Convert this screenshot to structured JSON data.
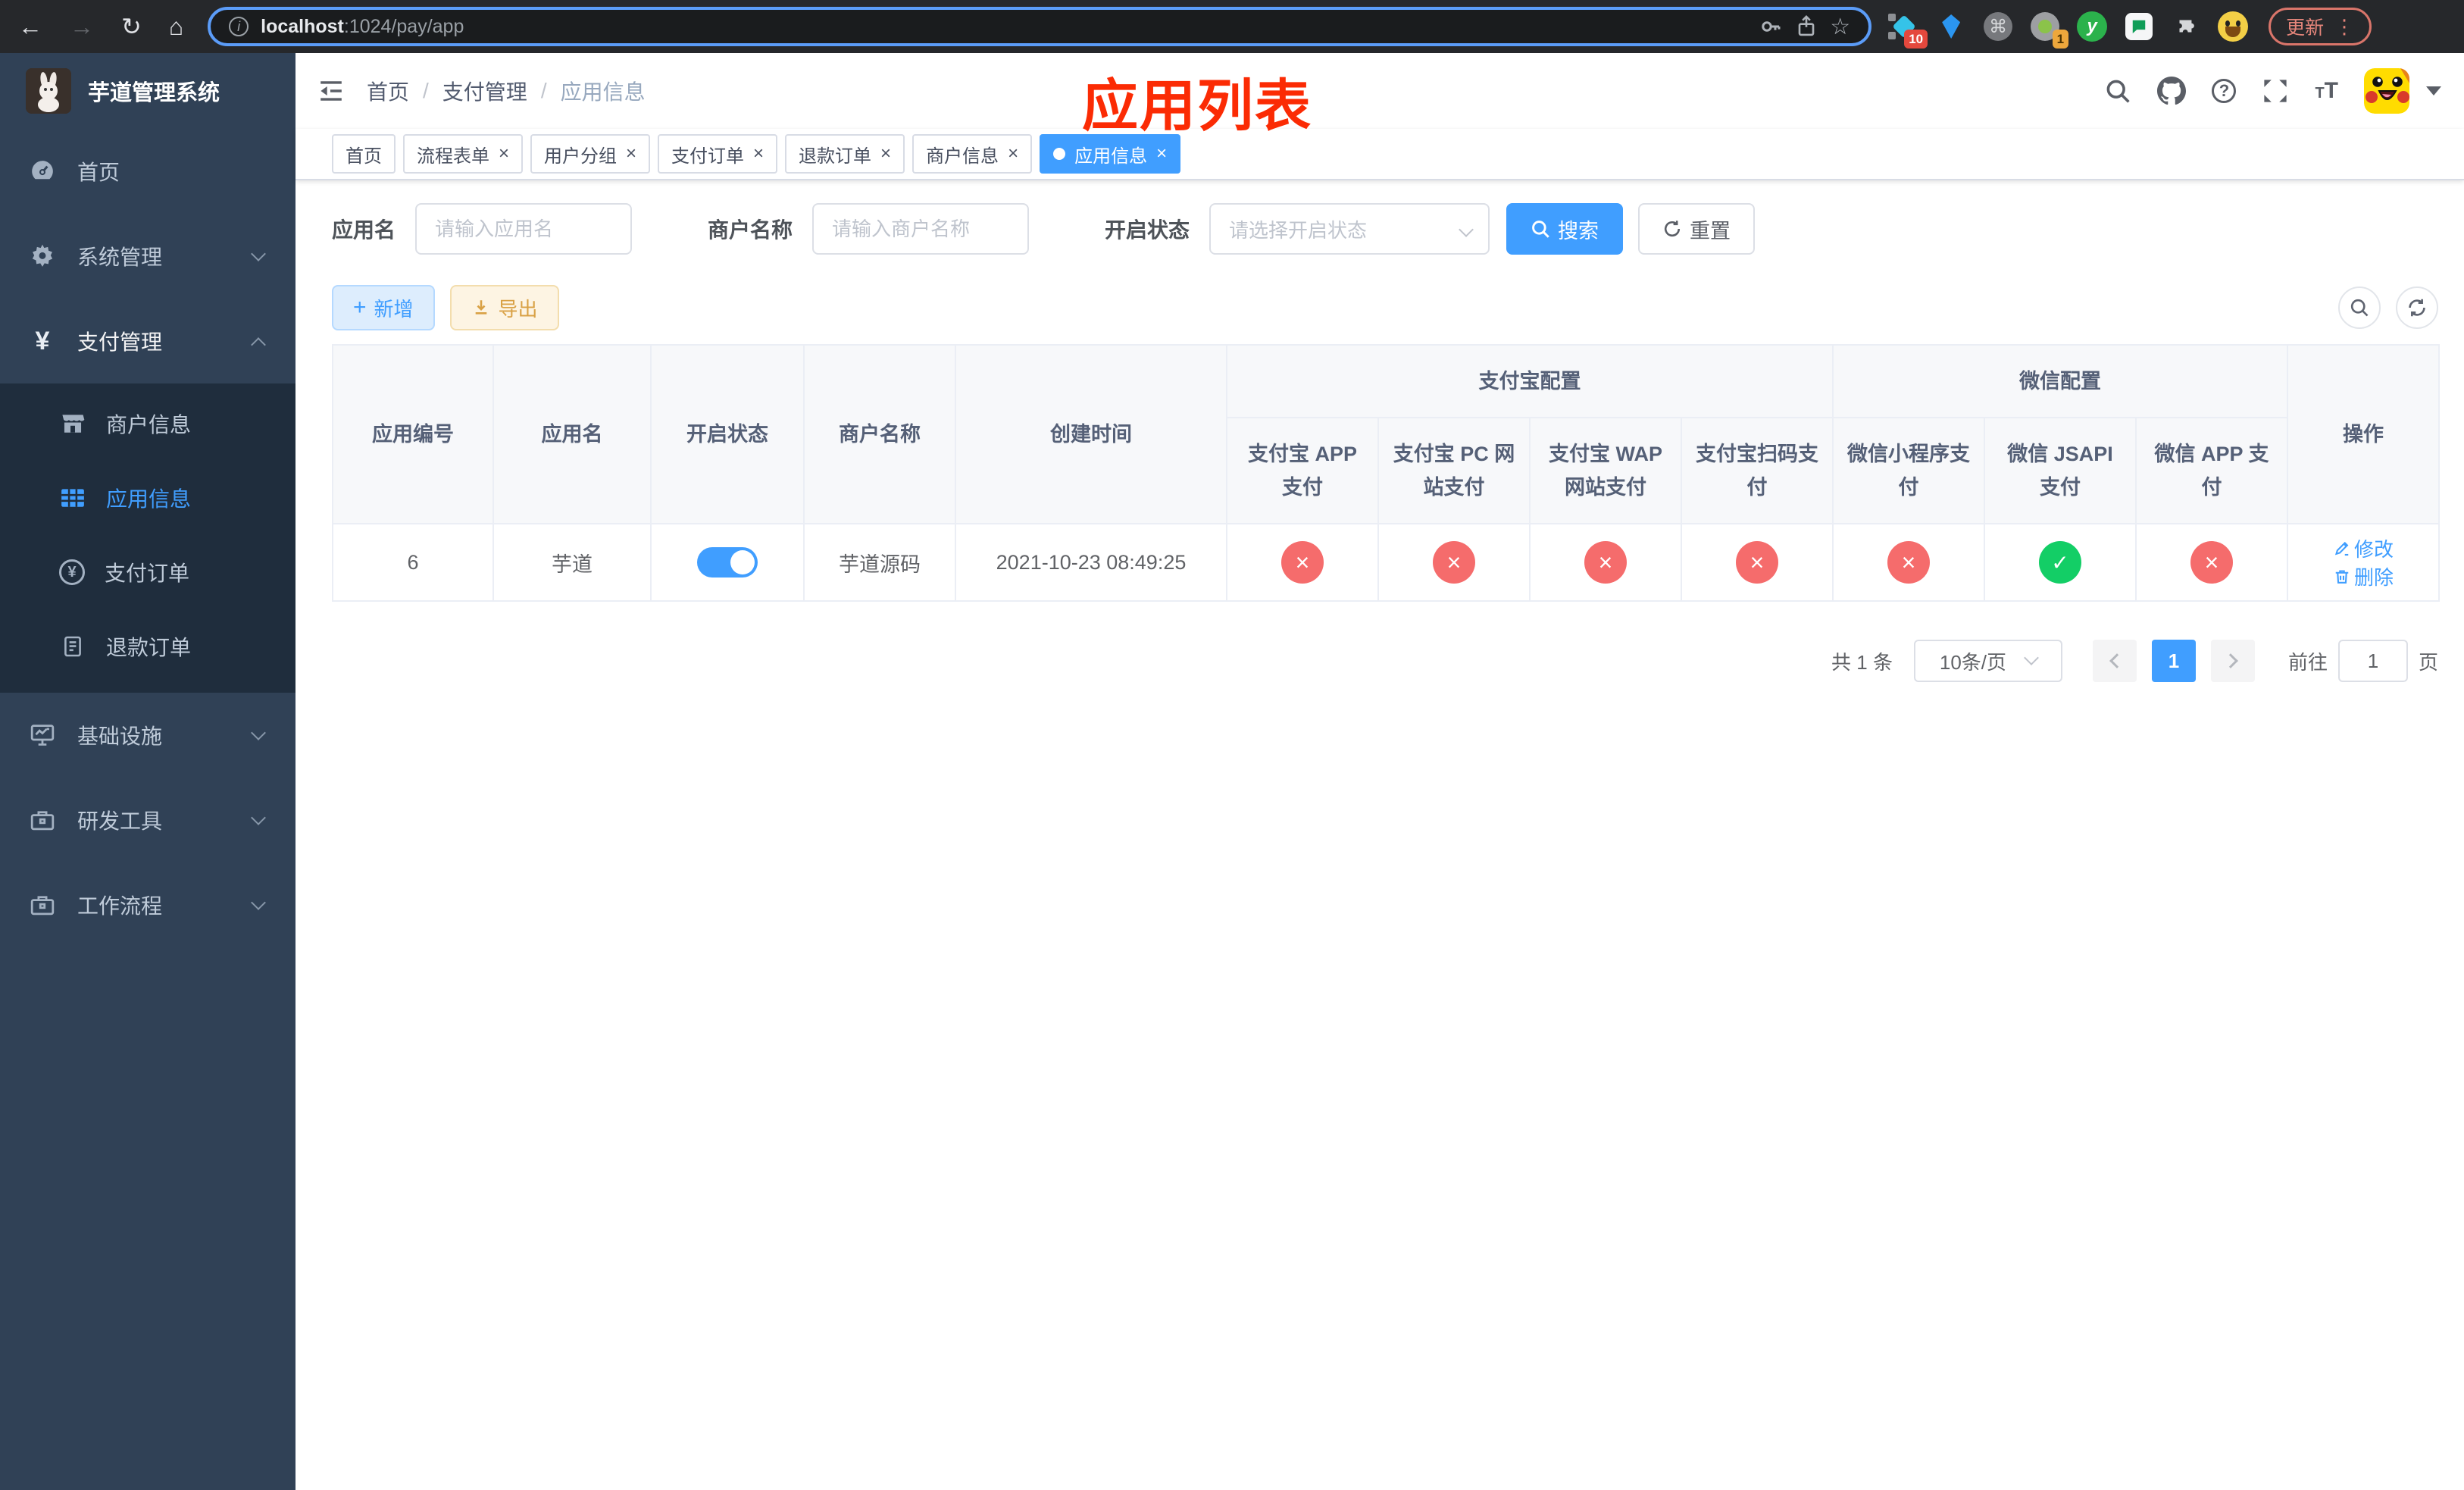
{
  "colors": {
    "accent": "#409eff",
    "success": "#13ce66",
    "danger": "#f56c6c",
    "warning": "#e6a23c",
    "annotation_red": "#fb2b04",
    "sidebar_bg": "#304156",
    "submenu_bg": "#1f2d3d",
    "browser_bg": "#26282b"
  },
  "browser": {
    "url_host": "localhost",
    "url_rest": ":1024/pay/app",
    "update_label": "更新",
    "ext_badge_1": "10",
    "ext_badge_4": "1"
  },
  "sidebar": {
    "title": "芋道管理系统",
    "items": [
      {
        "label": "首页"
      },
      {
        "label": "系统管理"
      },
      {
        "label": "支付管理"
      },
      {
        "label": "基础设施"
      },
      {
        "label": "研发工具"
      },
      {
        "label": "工作流程"
      }
    ],
    "payment_children": [
      {
        "label": "商户信息"
      },
      {
        "label": "应用信息",
        "active": true
      },
      {
        "label": "支付订单"
      },
      {
        "label": "退款订单"
      }
    ]
  },
  "navbar": {
    "breadcrumb": [
      {
        "label": "首页"
      },
      {
        "label": "支付管理"
      },
      {
        "label": "应用信息"
      }
    ],
    "annotation": "应用列表"
  },
  "tabs": [
    {
      "label": "首页",
      "closable": false
    },
    {
      "label": "流程表单",
      "closable": true
    },
    {
      "label": "用户分组",
      "closable": true
    },
    {
      "label": "支付订单",
      "closable": true
    },
    {
      "label": "退款订单",
      "closable": true
    },
    {
      "label": "商户信息",
      "closable": true
    },
    {
      "label": "应用信息",
      "closable": true,
      "active": true
    }
  ],
  "filters": {
    "app_name_label": "应用名",
    "app_name_placeholder": "请输入应用名",
    "merchant_label": "商户名称",
    "merchant_placeholder": "请输入商户名称",
    "status_label": "开启状态",
    "status_placeholder": "请选择开启状态",
    "search_label": "搜索",
    "reset_label": "重置"
  },
  "toolbar": {
    "add_label": "新增",
    "export_label": "导出"
  },
  "table": {
    "headers": {
      "app_id": "应用编号",
      "app_name": "应用名",
      "status": "开启状态",
      "merchant": "商户名称",
      "created": "创建时间",
      "alipay_group": "支付宝配置",
      "wechat_group": "微信配置",
      "actions": "操作"
    },
    "alipay_cols": [
      "支付宝 APP 支付",
      "支付宝 PC 网站支付",
      "支付宝 WAP 网站支付",
      "支付宝扫码支付"
    ],
    "wechat_cols": [
      "微信小程序支付",
      "微信 JSAPI 支付",
      "微信 APP 支付"
    ],
    "row": {
      "id": "6",
      "name": "芋道",
      "toggle": "on",
      "merchant": "芋道源码",
      "created": "2021-10-23 08:49:25",
      "statuses": [
        "no",
        "no",
        "no",
        "no",
        "no",
        "yes",
        "no"
      ],
      "edit_label": "修改",
      "delete_label": "删除"
    }
  },
  "pagination": {
    "total": "共 1 条",
    "page_size": "10条/页",
    "current": "1",
    "goto_label": "前往",
    "goto_value": "1",
    "unit_label": "页"
  }
}
